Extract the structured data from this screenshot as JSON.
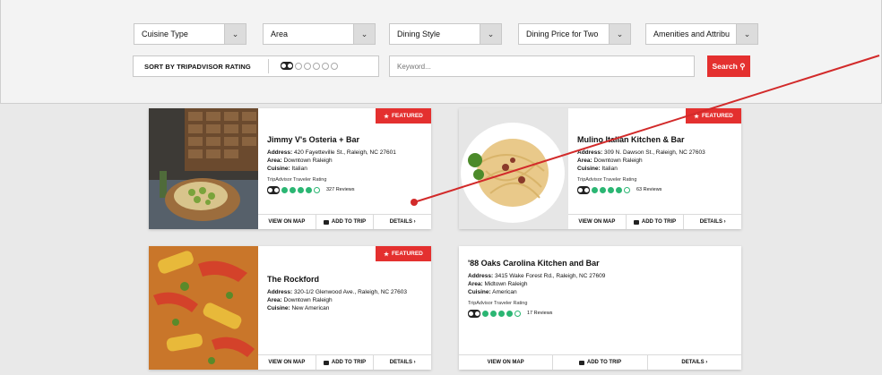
{
  "filters": {
    "cuisine": "Cuisine Type",
    "area": "Area",
    "dining_style": "Dining Style",
    "price": "Dining Price for Two",
    "amenities": "Amenities and Attribu",
    "sort_label": "SORT BY TRIPADVISOR RATING",
    "keyword_placeholder": "Keyword...",
    "search_label": "Search"
  },
  "colors": {
    "accent": "#e4302f",
    "rating_green": "#2bb673"
  },
  "cards": [
    {
      "title": "Jimmy V's Osteria + Bar",
      "address": "420 Fayetteville St., Raleigh, NC 27601",
      "area": "Downtown Raleigh",
      "cuisine": "Italian",
      "rating_dots": 4,
      "reviews": "327 Reviews",
      "featured": "FEATURED"
    },
    {
      "title": "Mulino Italian Kitchen & Bar",
      "address": "309 N. Dawson St., Raleigh, NC 27603",
      "area": "Downtown Raleigh",
      "cuisine": "Italian",
      "rating_dots": 4,
      "reviews": "63 Reviews",
      "featured": "FEATURED"
    },
    {
      "title": "The Rockford",
      "address": "320-1/2 Glenwood Ave., Raleigh, NC 27603",
      "area": "Downtown Raleigh",
      "cuisine": "New American",
      "featured": "FEATURED"
    },
    {
      "title": "'88 Oaks Carolina Kitchen and Bar",
      "address": "3415 Wake Forest Rd., Raleigh, NC 27609",
      "area": "Midtown Raleigh",
      "cuisine": "American",
      "rating_dots": 4,
      "reviews": "17 Reviews"
    }
  ],
  "labels": {
    "address": "Address:",
    "area": "Area:",
    "cuisine": "Cuisine:",
    "ta_rating": "TripAdvisor Traveler Rating",
    "view_map": "VIEW ON MAP",
    "add_trip": "ADD TO TRIP",
    "details": "DETAILS ›"
  }
}
